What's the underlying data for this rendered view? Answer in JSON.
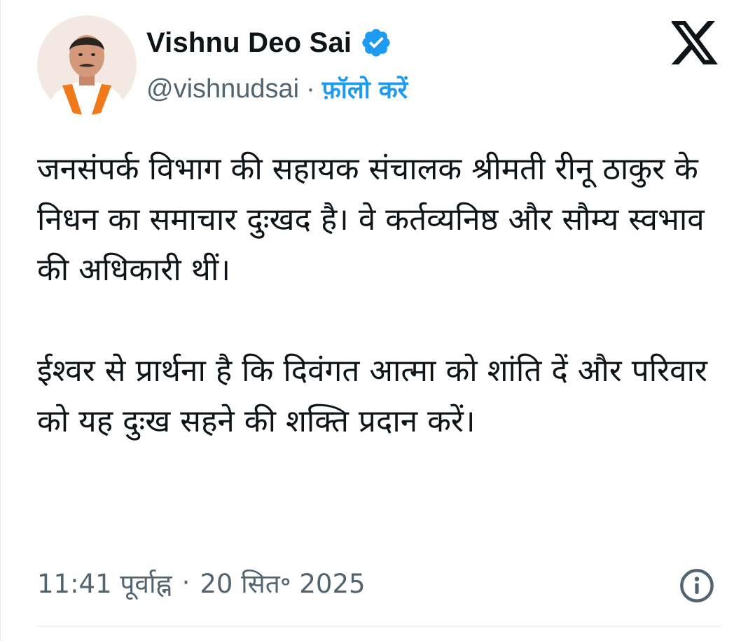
{
  "author": {
    "name": "Vishnu Deo Sai",
    "handle": "@vishnudsai",
    "separator": "·",
    "follow_label": "फ़ॉलो करें",
    "verified": true
  },
  "icons": {
    "verified": "verified-badge-icon",
    "logo": "x-logo-icon",
    "info": "info-icon"
  },
  "tweet": {
    "paragraphs": [
      "जनसंपर्क विभाग की सहायक संचालक श्रीमती रीनू ठाकुर के निधन का समाचार दुःखद है। वे कर्तव्यनिष्ठ और सौम्य स्वभाव की अधिकारी थीं।",
      "ईश्वर से प्रार्थना है कि दिवंगत आत्मा को शांति दें और परिवार को यह दुःख सहने की शक्ति प्रदान करें।"
    ]
  },
  "meta": {
    "time": "11:41 पूर्वाह्न",
    "separator": "·",
    "date": "20 सित॰ 2025"
  },
  "colors": {
    "accent": "#1d9bf0",
    "text": "#0f1419",
    "secondary": "#536471"
  }
}
